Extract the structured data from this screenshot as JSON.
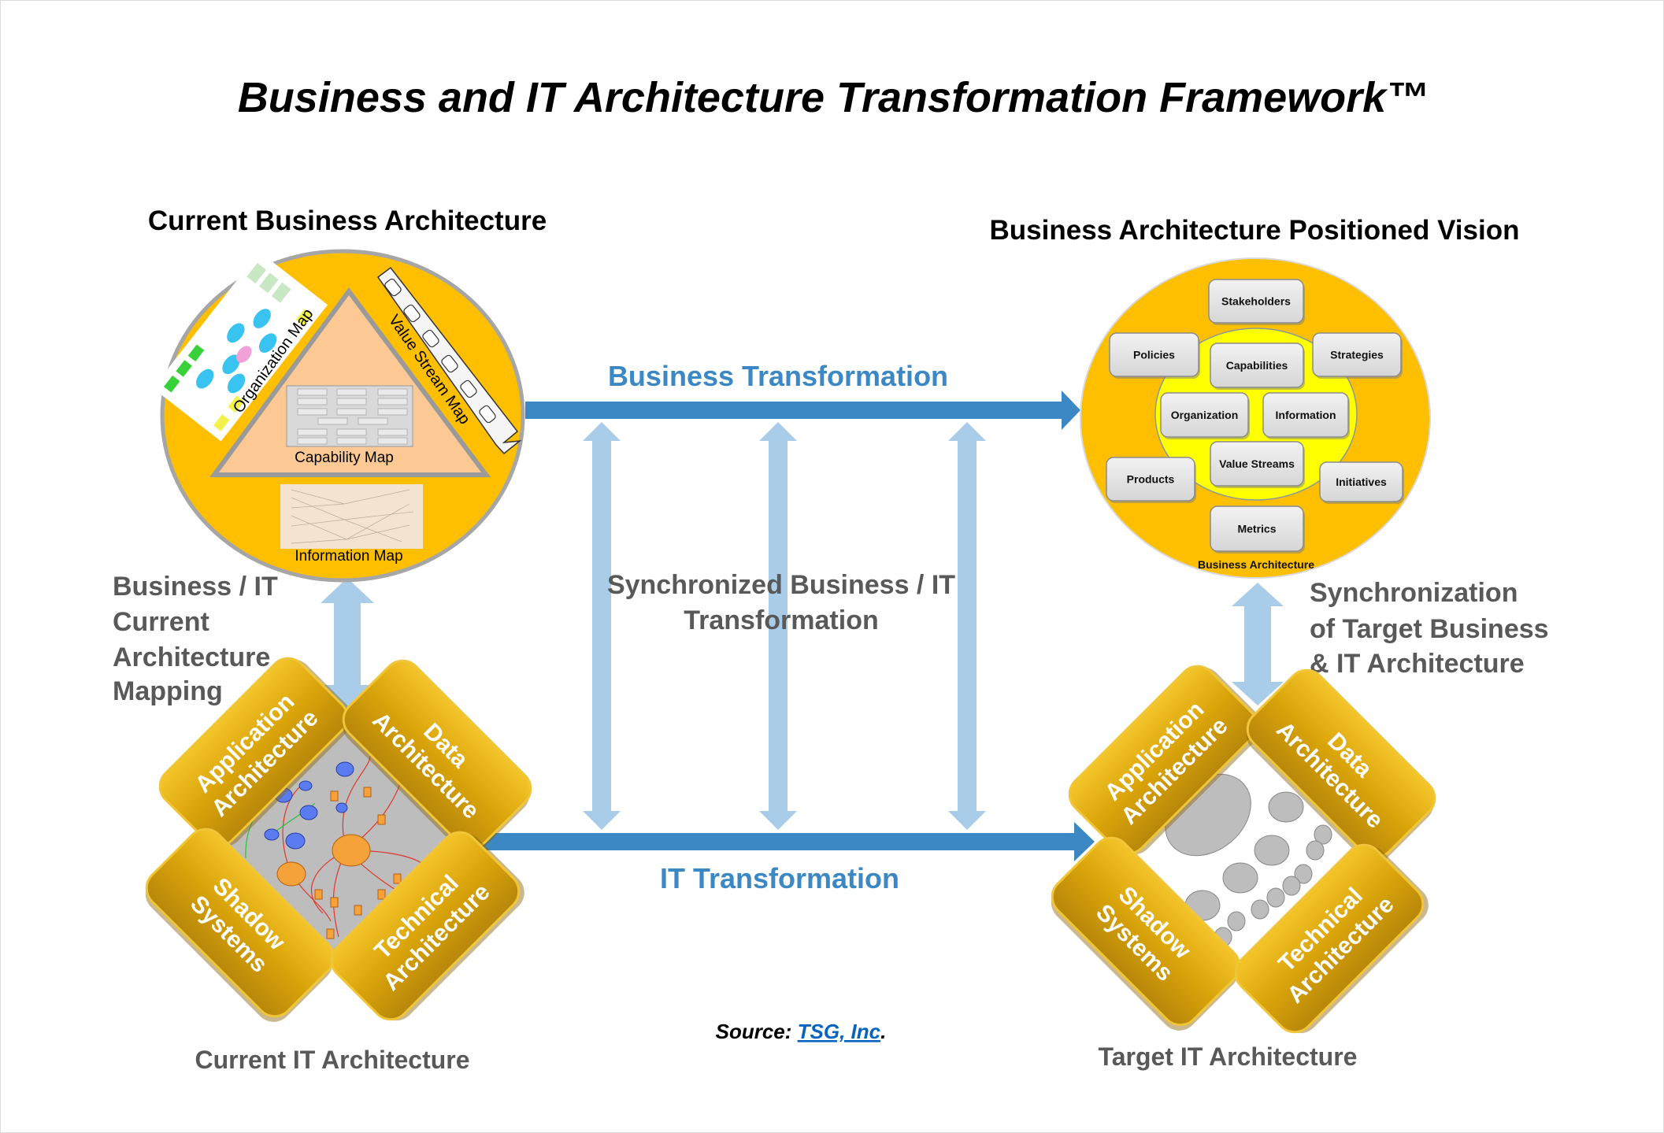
{
  "title": "Business and IT Architecture Transformation Framework™",
  "current_business": {
    "heading": "Current Business Architecture",
    "maps": {
      "organization": "Organization Map",
      "value_stream": "Value Stream Map",
      "capability": "Capability Map",
      "information": "Information Map"
    }
  },
  "vision": {
    "heading": "Business Architecture Positioned Vision",
    "boxes": [
      "Stakeholders",
      "Policies",
      "Capabilities",
      "Strategies",
      "Organization",
      "Information",
      "Value Streams",
      "Products",
      "Initiatives",
      "Metrics"
    ],
    "label": "Business Architecture"
  },
  "flows": {
    "business_transformation": "Business Transformation",
    "it_transformation": "IT Transformation",
    "synchronized": [
      "Synchronized Business / IT",
      "Transformation"
    ]
  },
  "mapping_left": [
    "Business / IT",
    "Current",
    "Architecture",
    "Mapping"
  ],
  "sync_right": [
    "Synchronization",
    "of Target Business",
    "& IT Architecture"
  ],
  "current_it": {
    "label": "Current IT Architecture",
    "tiles": [
      [
        "Application",
        "Architecture"
      ],
      [
        "Data",
        "Architecture"
      ],
      [
        "Shadow",
        "Systems"
      ],
      [
        "Technical",
        "Architecture"
      ]
    ]
  },
  "target_it": {
    "label": "Target IT Architecture",
    "tiles": [
      [
        "Application",
        "Architecture"
      ],
      [
        "Data",
        "Architecture"
      ],
      [
        "Shadow",
        "Systems"
      ],
      [
        "Technical",
        "Architecture"
      ]
    ]
  },
  "source": {
    "prefix": "Source: ",
    "link": "TSG, Inc",
    "suffix": "."
  },
  "colors": {
    "circle_fill": "#fdbf00",
    "inner_circle": "#ffff00",
    "triangle": "#fcc995",
    "tile_gold": "#d9a40a",
    "arrow_dark_blue": "#3b88c4",
    "arrow_light_blue": "#a9cde9",
    "text_gray": "#595959",
    "link": "#0563c1"
  }
}
